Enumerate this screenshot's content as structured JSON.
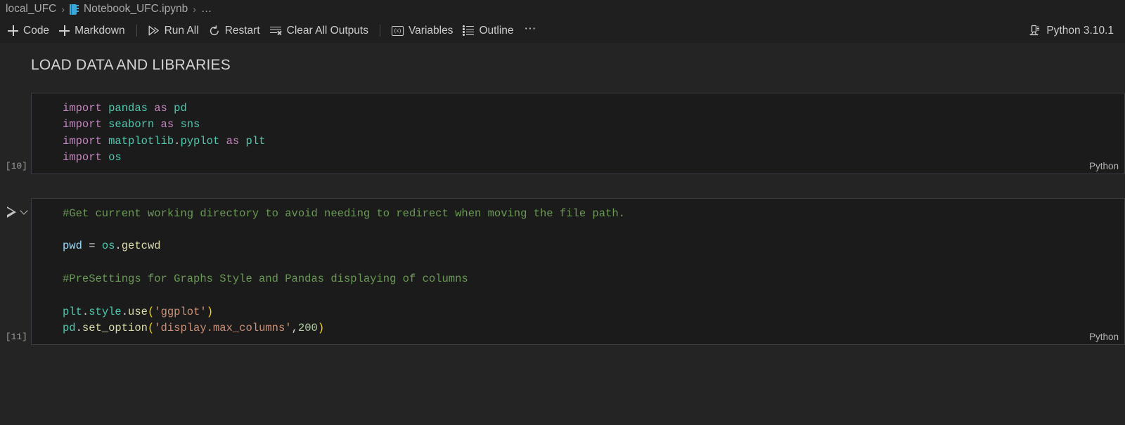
{
  "breadcrumb": {
    "items": [
      {
        "label": "local_UFC",
        "icon": null
      },
      {
        "label": "Notebook_UFC.ipynb",
        "icon": "notebook-icon"
      },
      {
        "label": "…",
        "icon": null
      }
    ],
    "separator": "›"
  },
  "toolbar": {
    "add_code_label": "Code",
    "add_markdown_label": "Markdown",
    "run_all_label": "Run All",
    "restart_label": "Restart",
    "clear_all_outputs_label": "Clear All Outputs",
    "variables_label": "Variables",
    "variables_icon_text": "(x)",
    "outline_label": "Outline",
    "more_label": "⋯",
    "kernel_label": "Python 3.10.1"
  },
  "notebook": {
    "markdown_cell": {
      "heading": "LOAD DATA AND LIBRARIES"
    },
    "cells": [
      {
        "exec_count": "[10]",
        "language": "Python",
        "lines": [
          [
            {
              "t": "import ",
              "c": "t-kw"
            },
            {
              "t": "pandas ",
              "c": "t-mod"
            },
            {
              "t": "as ",
              "c": "t-kw"
            },
            {
              "t": "pd",
              "c": "t-mod"
            }
          ],
          [
            {
              "t": "import ",
              "c": "t-kw"
            },
            {
              "t": "seaborn ",
              "c": "t-mod"
            },
            {
              "t": "as ",
              "c": "t-kw"
            },
            {
              "t": "sns",
              "c": "t-mod"
            }
          ],
          [
            {
              "t": "import ",
              "c": "t-kw"
            },
            {
              "t": "matplotlib",
              "c": "t-mod"
            },
            {
              "t": ".",
              "c": "t-dot"
            },
            {
              "t": "pyplot ",
              "c": "t-mod"
            },
            {
              "t": "as ",
              "c": "t-kw"
            },
            {
              "t": "plt",
              "c": "t-mod"
            }
          ],
          [
            {
              "t": "import ",
              "c": "t-kw"
            },
            {
              "t": "os",
              "c": "t-mod"
            }
          ]
        ]
      },
      {
        "exec_count": "[11]",
        "language": "Python",
        "lines": [
          [
            {
              "t": "#Get current working directory to avoid needing to redirect when moving the file path.",
              "c": "t-cmt"
            }
          ],
          [],
          [
            {
              "t": "pwd",
              "c": "t-var"
            },
            {
              "t": " = ",
              "c": "t-op"
            },
            {
              "t": "os",
              "c": "t-mod"
            },
            {
              "t": ".",
              "c": "t-dot"
            },
            {
              "t": "getcwd",
              "c": "t-fn"
            }
          ],
          [],
          [
            {
              "t": "#PreSettings for Graphs Style and Pandas displaying of columns",
              "c": "t-cmt"
            }
          ],
          [],
          [
            {
              "t": "plt",
              "c": "t-mod"
            },
            {
              "t": ".",
              "c": "t-dot"
            },
            {
              "t": "style",
              "c": "t-mod"
            },
            {
              "t": ".",
              "c": "t-dot"
            },
            {
              "t": "use",
              "c": "t-fn"
            },
            {
              "t": "(",
              "c": "t-par"
            },
            {
              "t": "'ggplot'",
              "c": "t-str"
            },
            {
              "t": ")",
              "c": "t-par"
            }
          ],
          [
            {
              "t": "pd",
              "c": "t-mod"
            },
            {
              "t": ".",
              "c": "t-dot"
            },
            {
              "t": "set_option",
              "c": "t-fn"
            },
            {
              "t": "(",
              "c": "t-par"
            },
            {
              "t": "'display.max_columns'",
              "c": "t-str"
            },
            {
              "t": ",",
              "c": "t-op"
            },
            {
              "t": "200",
              "c": "t-num"
            },
            {
              "t": ")",
              "c": "t-par"
            }
          ]
        ]
      }
    ]
  },
  "colors": {
    "editor_bg": "#242424",
    "chrome_bg": "#1f1f1f",
    "cell_bg": "#1b1b1b",
    "cell_border": "#3b3b44",
    "accent_blue": "#3ba7d6",
    "text": "#cccccc"
  }
}
